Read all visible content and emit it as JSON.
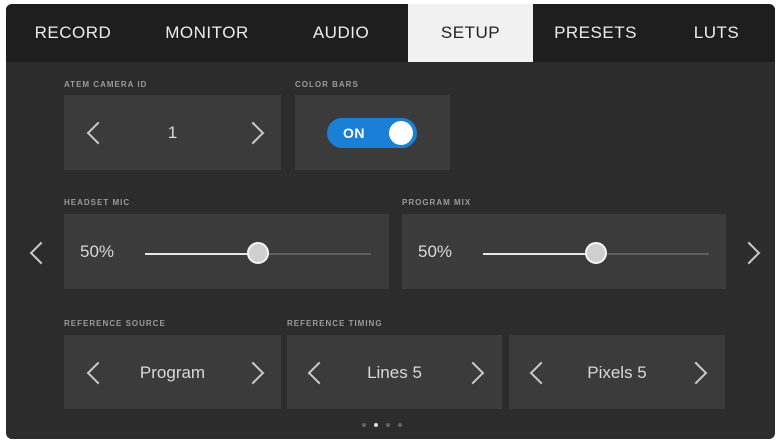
{
  "tabs": [
    {
      "label": "RECORD"
    },
    {
      "label": "MONITOR"
    },
    {
      "label": "AUDIO"
    },
    {
      "label": "SETUP"
    },
    {
      "label": "PRESETS"
    },
    {
      "label": "LUTS"
    }
  ],
  "active_tab": "SETUP",
  "atem_camera_id": {
    "label": "ATEM CAMERA ID",
    "value": "1"
  },
  "color_bars": {
    "label": "COLOR BARS",
    "state": "ON"
  },
  "headset_mic": {
    "label": "HEADSET MIC",
    "value": "50%",
    "level": 0.5
  },
  "program_mix": {
    "label": "PROGRAM MIX",
    "value": "50%",
    "level": 0.5
  },
  "reference_source": {
    "label": "REFERENCE SOURCE",
    "value": "Program"
  },
  "reference_timing": {
    "label": "REFERENCE TIMING",
    "lines": "Lines 5",
    "pixels": "Pixels 5"
  },
  "pagination": {
    "pages": 4,
    "current": 2
  },
  "colors": {
    "accent": "#1a7fd6",
    "background": "#2c2c2c",
    "panel": "#3b3b3b",
    "tabbar": "#1e1e1e"
  }
}
